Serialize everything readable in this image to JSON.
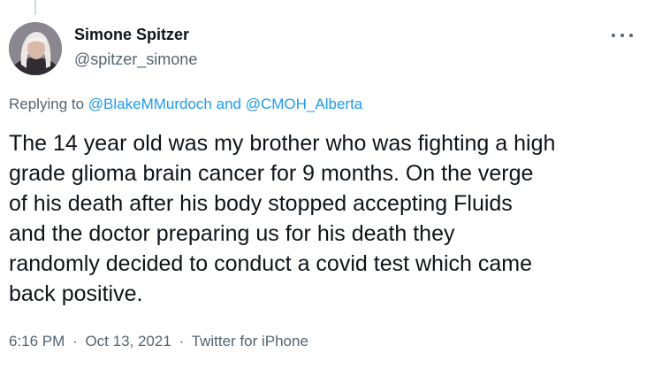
{
  "tweet": {
    "author": {
      "display_name": "Simone Spitzer",
      "handle": "@spitzer_simone",
      "avatar_icon": "profile-photo"
    },
    "more_icon": "more-horizontal-icon",
    "reply_context": {
      "prefix": "Replying to",
      "mention_1": "@BlakeMMurdoch",
      "conjunction": "and",
      "mention_2": "@CMOH_Alberta"
    },
    "text": "The 14 year old was my brother who was fighting a high\ngrade glioma brain cancer for 9 months. On the verge\nof his death after his body stopped accepting Fluids\nand the doctor preparing us for his death they\nrandomly decided to conduct a covid test which came\nback positive.",
    "time": "6:16 PM",
    "separator": "·",
    "date": "Oct 13, 2021",
    "source": "Twitter for iPhone"
  },
  "colors": {
    "text_primary": "#0f1419",
    "text_secondary": "#536471",
    "link": "#1d9bf0",
    "thread_line": "#cfd9de"
  }
}
